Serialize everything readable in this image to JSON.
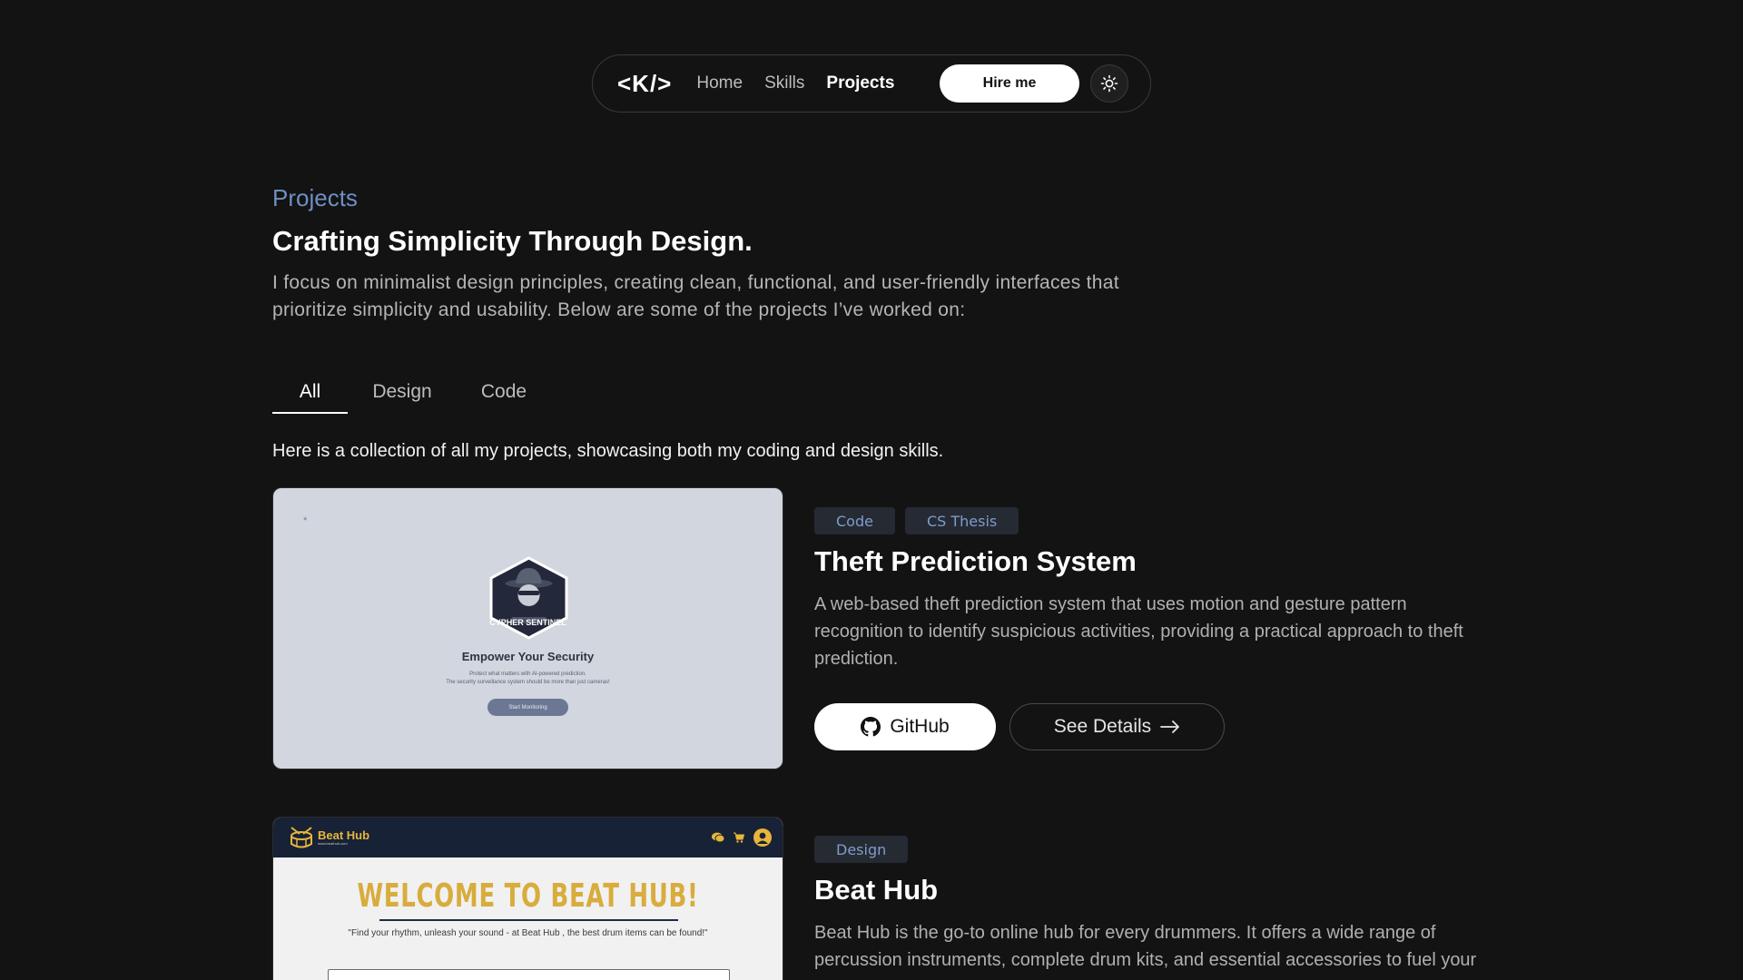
{
  "nav": {
    "logo": "<K/>",
    "links": [
      "Home",
      "Skills",
      "Projects"
    ],
    "active": "Projects",
    "hire_label": "Hire me",
    "theme_icon": "sun-icon"
  },
  "header": {
    "eyebrow": "Projects",
    "headline": "Crafting Simplicity Through Design.",
    "intro": "I focus on minimalist design principles, creating clean, functional, and user-friendly interfaces that prioritize simplicity and usability. Below are some of the projects I’ve worked on:"
  },
  "tabs": [
    {
      "label": "All",
      "active": true
    },
    {
      "label": "Design",
      "active": false
    },
    {
      "label": "Code",
      "active": false
    }
  ],
  "collection_text": "Here is a collection of all my projects, showcasing both my coding and design skills.",
  "projects": [
    {
      "tags": [
        "Code",
        "CS Thesis"
      ],
      "title": "Theft Prediction System",
      "description": "A web-based theft prediction system that uses motion and gesture pattern recognition to identify suspicious activities, providing a practical approach to theft prediction.",
      "github_label": "GitHub",
      "details_label": "See Details",
      "thumbnail": {
        "dot": "*",
        "brand": "CYPHER SENTINEL",
        "title": "Empower Your Security",
        "subtitle_1": "Protect what matters with AI-powered prediction.",
        "subtitle_2": "The security surveillance system should be more than just cameras!",
        "button": "Start Monitoring"
      }
    },
    {
      "tags": [
        "Design"
      ],
      "title": "Beat Hub",
      "description": "Beat Hub is the go-to online hub for every drummers. It offers a wide range of percussion instruments, complete drum kits, and essential accessories to fuel your",
      "thumbnail": {
        "logo": "Beat Hub",
        "logo_sub": "www.beathub.com",
        "welcome": "WELCOME TO BEAT HUB!",
        "quote": "\"Find your rhythm, unleash your sound - at Beat Hub , the best drum items can be found!\""
      }
    }
  ],
  "colors": {
    "background": "#131313",
    "accent": "#6f8fc2",
    "tag_bg": "#252a33",
    "tag_text": "#7f9dc9",
    "beat_gold": "#d8ac3d",
    "beat_navy": "#172236"
  }
}
